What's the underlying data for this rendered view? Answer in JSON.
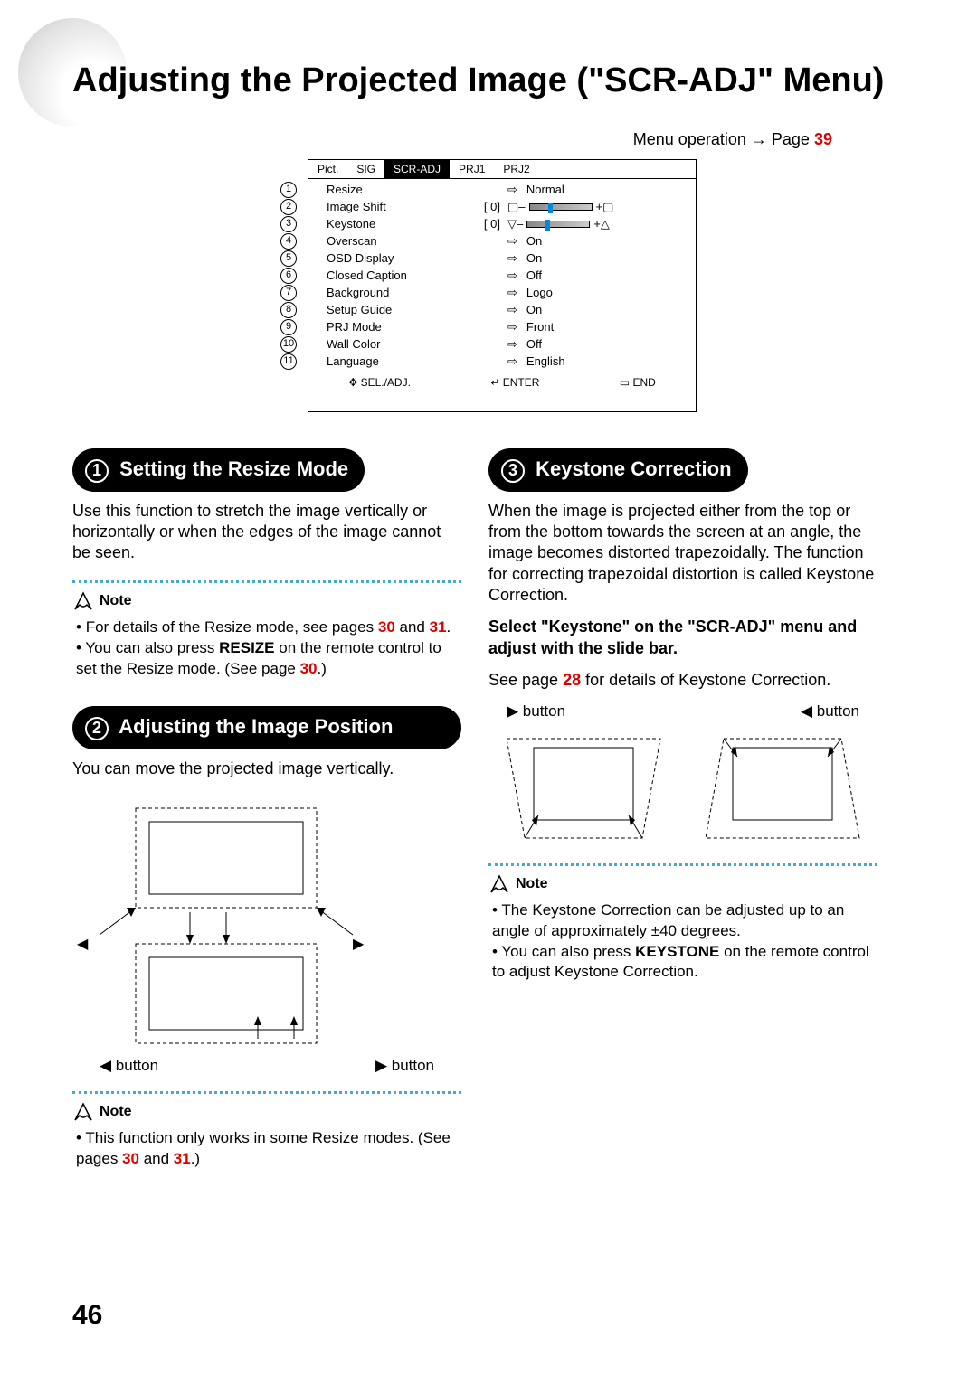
{
  "page": {
    "title": "Adjusting the Projected Image (\"SCR-ADJ\" Menu)",
    "menuOperation": "Menu operation",
    "menuOpArrow": "→",
    "menuOpPage": "Page",
    "menuOpNum": "39",
    "pageNumber": "46"
  },
  "menu": {
    "tabs": [
      "Pict.",
      "SIG",
      "SCR-ADJ",
      "PRJ1",
      "PRJ2"
    ],
    "activeTab": "SCR-ADJ",
    "rows": [
      {
        "n": "1",
        "label": "Resize",
        "mid": "",
        "value": "Normal",
        "type": "arrow"
      },
      {
        "n": "2",
        "label": "Image Shift",
        "mid": "[      0]",
        "value": "",
        "type": "slider",
        "icons": "shift"
      },
      {
        "n": "3",
        "label": "Keystone",
        "mid": "[      0]",
        "value": "",
        "type": "slider",
        "icons": "keystone"
      },
      {
        "n": "4",
        "label": "Overscan",
        "mid": "",
        "value": "On",
        "type": "arrow"
      },
      {
        "n": "5",
        "label": "OSD Display",
        "mid": "",
        "value": "On",
        "type": "arrow"
      },
      {
        "n": "6",
        "label": "Closed Caption",
        "mid": "",
        "value": "Off",
        "type": "arrow"
      },
      {
        "n": "7",
        "label": "Background",
        "mid": "",
        "value": "Logo",
        "type": "arrow"
      },
      {
        "n": "8",
        "label": "Setup Guide",
        "mid": "",
        "value": "On",
        "type": "arrow"
      },
      {
        "n": "9",
        "label": "PRJ Mode",
        "mid": "",
        "value": "Front",
        "type": "arrow"
      },
      {
        "n": "10",
        "label": "Wall Color",
        "mid": "",
        "value": "Off",
        "type": "arrow"
      },
      {
        "n": "11",
        "label": "Language",
        "mid": "",
        "value": "English",
        "type": "arrow"
      }
    ],
    "footer": {
      "sel": "SEL./ADJ.",
      "enter": "ENTER",
      "end": "END"
    }
  },
  "sec1": {
    "num": "1",
    "title": "Setting the Resize Mode",
    "body": "Use this function to stretch the image vertically or horizontally or when the edges of the image cannot be seen.",
    "noteLabel": "Note",
    "notes": {
      "a_pre": "For details of the Resize mode, see pages ",
      "a_r1": "30",
      "a_mid": " and ",
      "a_r2": "31",
      "a_post": ".",
      "b_pre": "You can also press ",
      "b_bold": "RESIZE",
      "b_mid": " on the remote control to set the Resize mode. (See page ",
      "b_r": "30",
      "b_post": ".)"
    }
  },
  "sec2": {
    "num": "2",
    "title": "Adjusting the Image Position",
    "body": "You can move the projected image vertically.",
    "btnLeft": "button",
    "btnRight": "button",
    "noteLabel": "Note",
    "notes": {
      "a_pre": "This function only works in some Resize modes. (See pages ",
      "a_r1": "30",
      "a_mid": " and ",
      "a_r2": "31",
      "a_post": ".)"
    }
  },
  "sec3": {
    "num": "3",
    "title": "Keystone Correction",
    "body": "When the image is projected either from the top or from the bottom towards the screen at an angle, the image becomes distorted trapezoidally. The function for correcting trapezoidal distortion is called Keystone Correction.",
    "bold": "Select \"Keystone\" on the \"SCR-ADJ\" menu and adjust with the slide bar.",
    "seePre": "See page ",
    "seeR": "28",
    "seePost": " for details of Keystone Correction.",
    "btnRight": "button",
    "btnLeft": "button",
    "noteLabel": "Note",
    "notes": {
      "a": "The Keystone Correction can be adjusted up to an angle of approximately ±40 degrees.",
      "b_pre": "You can also press ",
      "b_bold": "KEYSTONE",
      "b_post": " on the remote control to adjust Keystone Correction."
    }
  }
}
